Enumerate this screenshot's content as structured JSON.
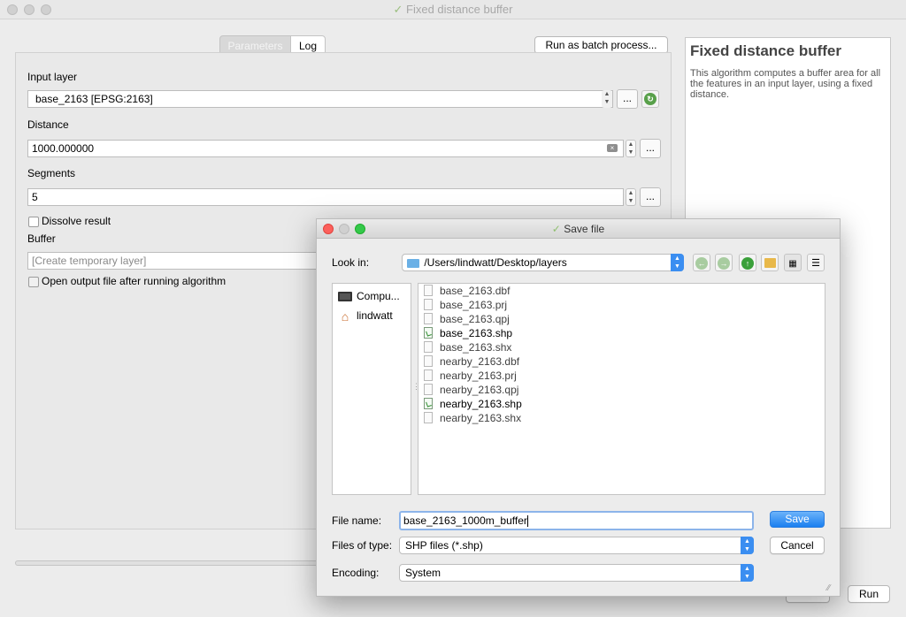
{
  "window": {
    "title": "Fixed distance buffer"
  },
  "tabs": [
    {
      "label": "Parameters"
    },
    {
      "label": "Log"
    }
  ],
  "batch_button": "Run as batch process...",
  "form": {
    "input_layer_label": "Input layer",
    "input_layer_value": "base_2163 [EPSG:2163]",
    "distance_label": "Distance",
    "distance_value": "1000.000000",
    "segments_label": "Segments",
    "segments_value": "5",
    "dissolve_label": "Dissolve result",
    "buffer_label": "Buffer",
    "buffer_placeholder": "[Create temporary layer]",
    "open_output_label": "Open output file after running algorithm",
    "ellipsis": "..."
  },
  "help": {
    "title": "Fixed distance buffer",
    "text": "This algorithm computes a buffer area for all the features in an input layer, using a fixed distance."
  },
  "run_button": "Run",
  "dialog": {
    "title": "Save file",
    "look_in_label": "Look in:",
    "look_in_path": "/Users/lindwatt/Desktop/layers",
    "sidebar": [
      {
        "label": "Compu...",
        "icon": "computer-icon"
      },
      {
        "label": "lindwatt",
        "icon": "home-icon"
      }
    ],
    "files": [
      {
        "name": "base_2163.dbf",
        "type": "file"
      },
      {
        "name": "base_2163.prj",
        "type": "file"
      },
      {
        "name": "base_2163.qpj",
        "type": "file"
      },
      {
        "name": "base_2163.shp",
        "type": "shp"
      },
      {
        "name": "base_2163.shx",
        "type": "file"
      },
      {
        "name": "nearby_2163.dbf",
        "type": "file"
      },
      {
        "name": "nearby_2163.prj",
        "type": "file"
      },
      {
        "name": "nearby_2163.qpj",
        "type": "file"
      },
      {
        "name": "nearby_2163.shp",
        "type": "shp"
      },
      {
        "name": "nearby_2163.shx",
        "type": "file"
      }
    ],
    "file_name_label": "File name:",
    "file_name_value": "base_2163_1000m_buffer",
    "files_of_type_label": "Files of type:",
    "files_of_type_value": "SHP files (*.shp)",
    "encoding_label": "Encoding:",
    "encoding_value": "System",
    "save_button": "Save",
    "cancel_button": "Cancel"
  },
  "colors": {
    "accent": "#3b8ef1",
    "folder": "#6ab0e6"
  }
}
